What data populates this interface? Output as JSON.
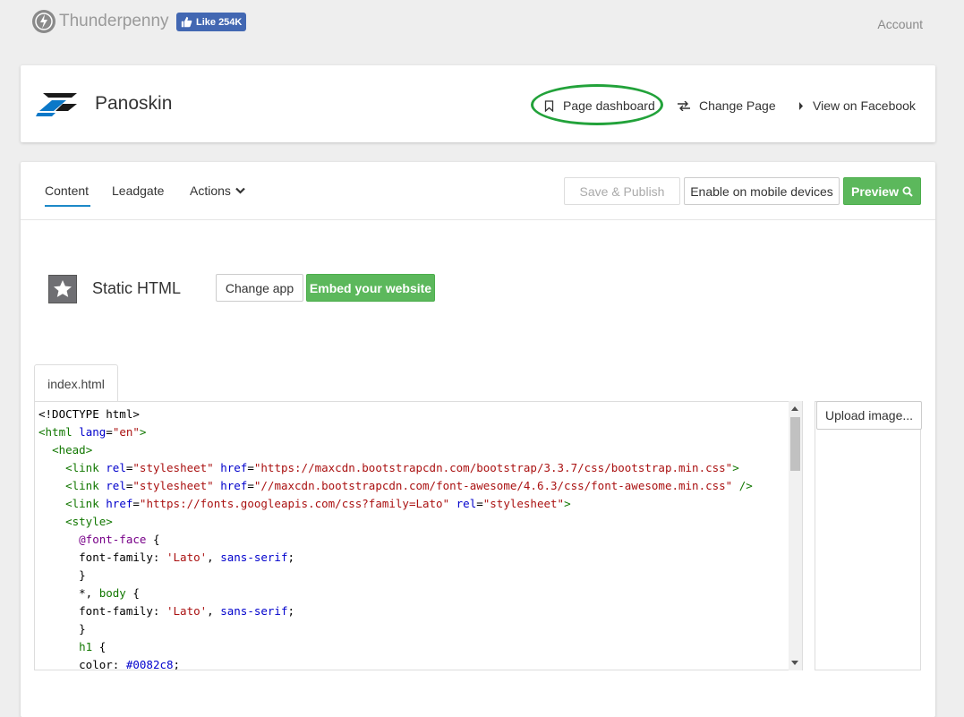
{
  "topbar": {
    "brand": "Thunderpenny",
    "fb_like": "Like 254K",
    "account": "Account"
  },
  "page": {
    "name": "Panoskin",
    "nav": {
      "dashboard": "Page dashboard",
      "change": "Change Page",
      "view": "View on Facebook"
    }
  },
  "tabs": {
    "content": "Content",
    "leadgate": "Leadgate",
    "actions": "Actions"
  },
  "toolbar": {
    "save": "Save & Publish",
    "mobile": "Enable on mobile devices",
    "preview": "Preview"
  },
  "app": {
    "name": "Static HTML",
    "change": "Change app",
    "embed": "Embed your website"
  },
  "editor": {
    "file_tab": "index.html",
    "upload": "Upload image..."
  },
  "colors": {
    "accent": "#1d89c8",
    "green": "#5cb85c",
    "highlight": "#22a23a"
  }
}
